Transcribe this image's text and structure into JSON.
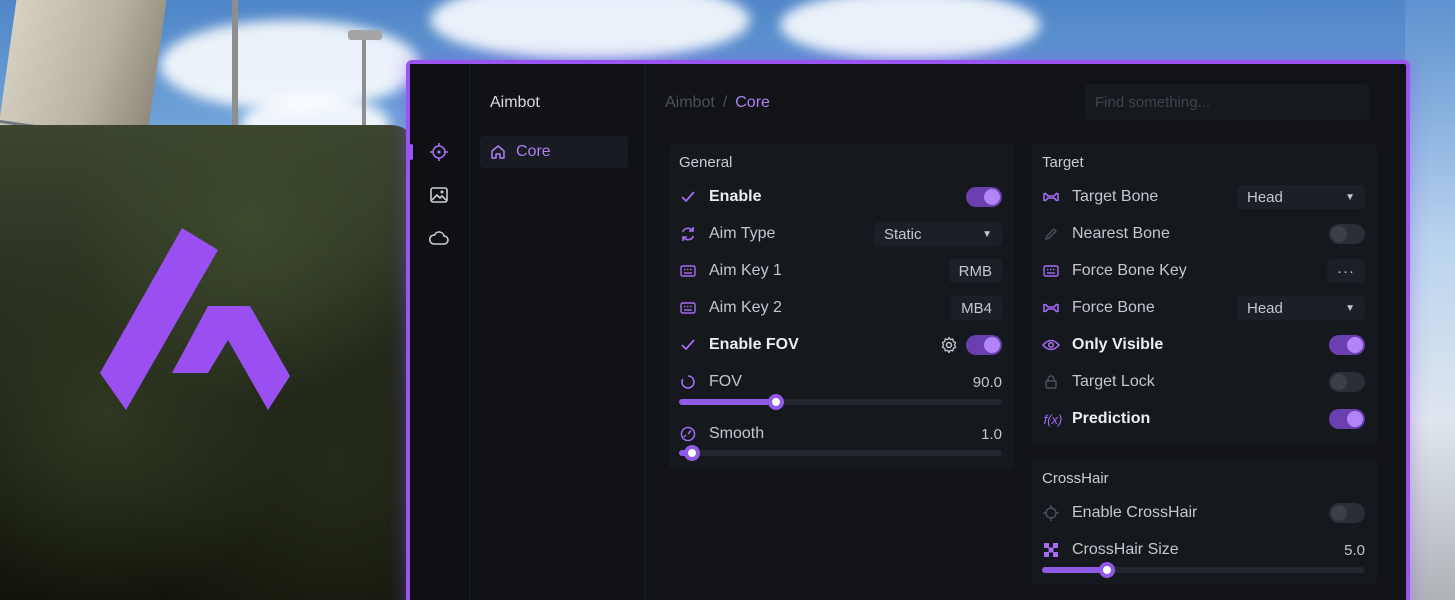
{
  "app": {
    "accent": "#9a55f0"
  },
  "rail": {
    "items": [
      {
        "icon": "crosshair-icon",
        "active": true
      },
      {
        "icon": "image-icon",
        "active": false
      },
      {
        "icon": "cloud-icon",
        "active": false
      }
    ]
  },
  "nav": {
    "title": "Aimbot",
    "items": [
      {
        "label": "Core",
        "icon": "home-icon"
      }
    ]
  },
  "breadcrumb": {
    "parent": "Aimbot",
    "separator": "/",
    "current": "Core"
  },
  "search": {
    "placeholder": "Find something..."
  },
  "general": {
    "title": "General",
    "enable": {
      "label": "Enable",
      "on": true
    },
    "aim_type": {
      "label": "Aim Type",
      "value": "Static"
    },
    "aim_key_1": {
      "label": "Aim Key 1",
      "value": "RMB"
    },
    "aim_key_2": {
      "label": "Aim Key 2",
      "value": "MB4"
    },
    "enable_fov": {
      "label": "Enable FOV",
      "on": true
    },
    "fov": {
      "label": "FOV",
      "value": "90.0",
      "fraction": 0.3
    },
    "smooth": {
      "label": "Smooth",
      "value": "1.0",
      "fraction": 0.04
    }
  },
  "target": {
    "title": "Target",
    "target_bone": {
      "label": "Target Bone",
      "value": "Head"
    },
    "nearest_bone": {
      "label": "Nearest Bone",
      "on": false
    },
    "force_bone_key": {
      "label": "Force Bone Key",
      "value": "···"
    },
    "force_bone": {
      "label": "Force Bone",
      "value": "Head"
    },
    "only_visible": {
      "label": "Only Visible",
      "on": true
    },
    "target_lock": {
      "label": "Target Lock",
      "on": false
    },
    "prediction": {
      "label": "Prediction",
      "icon_text": "f(x)",
      "on": true
    }
  },
  "crosshair": {
    "title": "CrossHair",
    "enable": {
      "label": "Enable CrossHair",
      "on": false
    },
    "size": {
      "label": "CrossHair Size",
      "value": "5.0",
      "fraction": 0.2
    }
  }
}
